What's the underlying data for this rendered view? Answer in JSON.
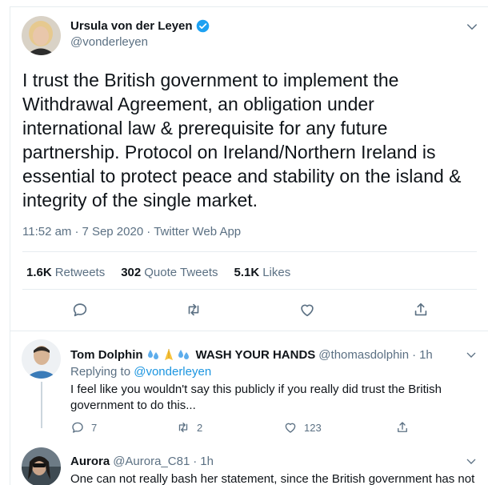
{
  "main_tweet": {
    "author_name": "Ursula von der Leyen",
    "author_handle": "@vonderleyen",
    "text": "I trust the British government to implement the\nWithdrawal Agreement, an obligation under\ninternational law & prerequisite for any future\npartnership. Protocol on Ireland/Northern Ireland is\nessential to protect peace and stability on the island &\nintegrity of the single market.",
    "time": "11:52 am",
    "date": "7 Sep 2020",
    "source": "Twitter Web App",
    "separator": "·",
    "stats": {
      "retweets_count": "1.6K",
      "retweets_label": "Retweets",
      "quotes_count": "302",
      "quotes_label": "Quote Tweets",
      "likes_count": "5.1K",
      "likes_label": "Likes"
    }
  },
  "replies": [
    {
      "name": "Tom Dolphin",
      "name_suffix": "WASH YOUR HANDS",
      "handle": "@thomasdolphin",
      "time": "1h",
      "replying_to_label": "Replying to",
      "replying_to_handle": "@vonderleyen",
      "text": "I feel like you wouldn't say this publicly if you really did trust the British government to do this...",
      "reply_count": "7",
      "retweet_count": "2",
      "like_count": "123"
    },
    {
      "name": "Aurora",
      "handle": "@Aurora_C81",
      "time": "1h",
      "text": "One can not really bash her statement, since the British government has not shown competence in recent times."
    }
  ],
  "colors": {
    "text_primary": "#0f1419",
    "text_secondary": "#5b7083",
    "link": "#1b95e0",
    "verified": "#1da1f2",
    "divider": "#e6ecf0",
    "icon": "#5b7083"
  }
}
